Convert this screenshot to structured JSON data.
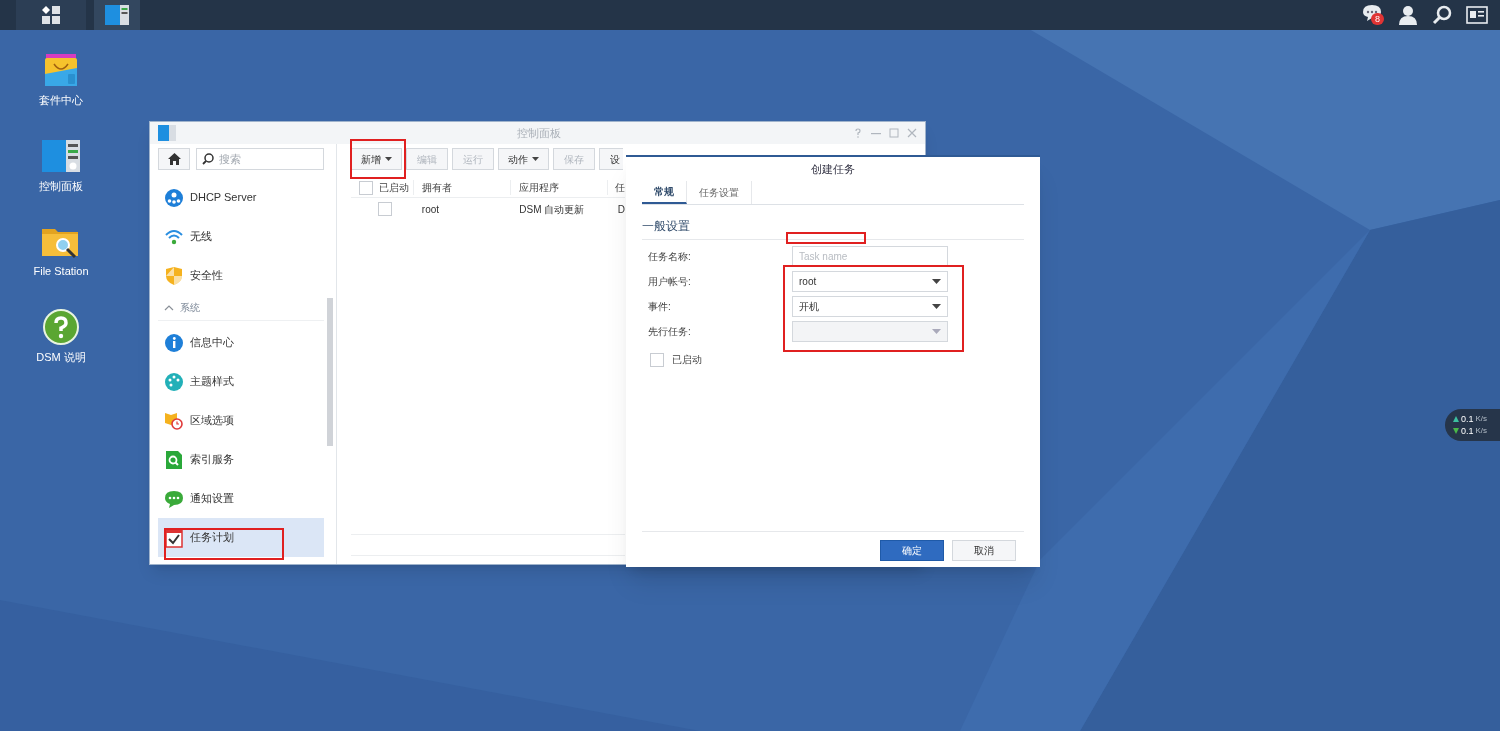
{
  "taskbar": {
    "notification_count": "8"
  },
  "desktop_icons": [
    {
      "kind": "package",
      "label": "套件中心"
    },
    {
      "kind": "panel",
      "label": "控制面板"
    },
    {
      "kind": "folder",
      "label": "File Station"
    },
    {
      "kind": "help",
      "label": "DSM 说明"
    }
  ],
  "control_panel": {
    "title": "控制面板",
    "search": {
      "placeholder": "搜索"
    },
    "sidebar": [
      {
        "kind": "item",
        "label": "DHCP Server",
        "selected": false
      },
      {
        "kind": "item",
        "label": "无线",
        "selected": false
      },
      {
        "kind": "item",
        "label": "安全性",
        "selected": false
      },
      {
        "kind": "section",
        "label": "系统",
        "expanded": true
      },
      {
        "kind": "item",
        "label": "信息中心",
        "selected": false
      },
      {
        "kind": "item",
        "label": "主题样式",
        "selected": false
      },
      {
        "kind": "item",
        "label": "区域选项",
        "selected": false
      },
      {
        "kind": "item",
        "label": "索引服务",
        "selected": false
      },
      {
        "kind": "item",
        "label": "通知设置",
        "selected": false
      },
      {
        "kind": "item",
        "label": "任务计划",
        "selected": true
      }
    ],
    "toolbar": [
      {
        "label": "新增",
        "dropdown": true,
        "disabled": false
      },
      {
        "label": "编辑",
        "dropdown": false,
        "disabled": true
      },
      {
        "label": "运行",
        "dropdown": false,
        "disabled": true
      },
      {
        "label": "动作",
        "dropdown": true,
        "disabled": false
      },
      {
        "label": "保存",
        "dropdown": false,
        "disabled": true
      },
      {
        "label": "设",
        "dropdown": false,
        "disabled": false
      }
    ],
    "table": {
      "all_checked": false,
      "columns": [
        "已启动",
        "拥有者",
        "应用程序",
        "任"
      ],
      "rows": [
        {
          "checked": false,
          "cells": [
            "",
            "root",
            "DSM 自动更新",
            "D"
          ]
        }
      ]
    }
  },
  "dialog": {
    "title": "创建任务",
    "tabs": [
      {
        "label": "常规",
        "selected": true
      },
      {
        "label": "任务设置",
        "selected": false
      }
    ],
    "section": "一般设置",
    "fields": [
      {
        "label": "任务名称:",
        "kind": "text",
        "placeholder": "Task name"
      },
      {
        "label": "用户帐号:",
        "kind": "select",
        "value": "root",
        "disabled": false
      },
      {
        "label": "事件:",
        "kind": "select",
        "value": "开机",
        "disabled": false
      },
      {
        "label": "先行任务:",
        "kind": "select",
        "disabled": true
      }
    ],
    "enabled": {
      "label": "已启动",
      "checked": false
    },
    "buttons": [
      {
        "label": "确定",
        "primary": true
      },
      {
        "label": "取消",
        "primary": false
      }
    ]
  },
  "network_speed": [
    {
      "reading": "0.1",
      "unit": "K/s"
    },
    {
      "reading": "0.1",
      "unit": "K/s"
    }
  ]
}
